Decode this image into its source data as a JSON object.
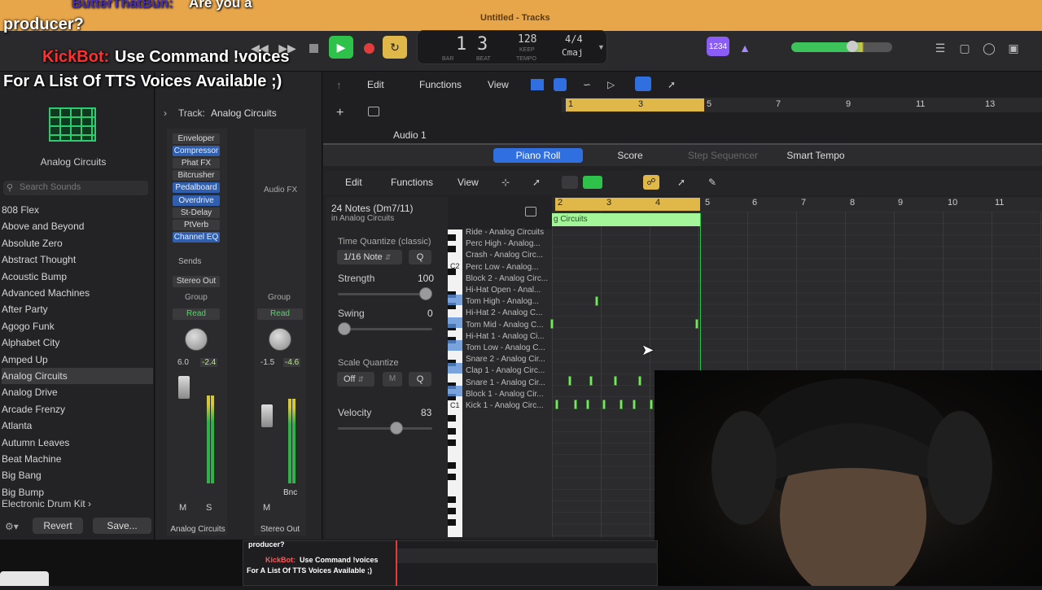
{
  "window": {
    "title": "Untitled - Tracks"
  },
  "chat": {
    "line1_user": "ButterThatBun:",
    "line1_msg": "Are you a",
    "line1b": "producer?",
    "line2_user": "KickBot:",
    "line2_msg": "Use Command !voices",
    "line3": "For A List Of TTS Voices Available ;)"
  },
  "lcd": {
    "bar": "1",
    "beat": "3",
    "bar_label": "BAR",
    "beat_label": "BEAT",
    "tempo": "128",
    "tempo_mode": "KEEP",
    "tempo_label": "TEMPO",
    "time_sig": "4/4",
    "key": "Cmaj",
    "count_in": "1234"
  },
  "library": {
    "patch_name": "Analog Circuits",
    "search_placeholder": "Search Sounds",
    "items": [
      "808 Flex",
      "Above and Beyond",
      "Absolute Zero",
      "Abstract Thought",
      "Acoustic Bump",
      "Advanced Machines",
      "After Party",
      "Agogo Funk",
      "Alphabet City",
      "Amped Up",
      "Analog Circuits",
      "Analog Drive",
      "Arcade Frenzy",
      "Atlanta",
      "Autumn Leaves",
      "Beat Machine",
      "Big Bang",
      "Big Bump"
    ],
    "selected": "Analog Circuits",
    "category": "Electronic Drum Kit",
    "revert": "Revert",
    "save": "Save..."
  },
  "inspector": {
    "track_label": "Track:",
    "track_name": "Analog Circuits",
    "plugins": [
      {
        "name": "Enveloper",
        "active": false
      },
      {
        "name": "Compressor",
        "active": true
      },
      {
        "name": "Phat FX",
        "active": false
      },
      {
        "name": "Bitcrusher",
        "active": false
      },
      {
        "name": "Pedalboard",
        "active": true
      },
      {
        "name": "Overdrive",
        "active": true
      },
      {
        "name": "St-Delay",
        "active": false
      },
      {
        "name": "PtVerb",
        "active": false
      },
      {
        "name": "Channel EQ",
        "active": true
      }
    ],
    "audio_fx": "Audio FX",
    "sends": "Sends",
    "output": "Stereo Out",
    "group": "Group",
    "read": "Read",
    "ch1_vol": "6.0",
    "ch1_peak": "-2.4",
    "ch2_vol": "-1.5",
    "ch2_peak": "-4.6",
    "bnc": "Bnc",
    "m": "M",
    "s": "S",
    "ch1_name": "Analog Circuits",
    "ch2_name": "Stereo Out"
  },
  "tracks": {
    "menus": [
      "Edit",
      "Functions",
      "View"
    ],
    "ruler": [
      "1",
      "3",
      "5",
      "7",
      "9",
      "11",
      "13"
    ],
    "audio_track": "Audio 1"
  },
  "piano_roll": {
    "tabs": [
      "Piano Roll",
      "Score",
      "Step Sequencer",
      "Smart Tempo"
    ],
    "menus": [
      "Edit",
      "Functions",
      "View"
    ],
    "region_info": "24 Notes (Dm7/11)",
    "region_track": "in Analog Circuits",
    "region_name": "g Circuits",
    "time_quantize_label": "Time Quantize (classic)",
    "time_quantize_value": "1/16 Note",
    "q": "Q",
    "strength_label": "Strength",
    "strength_value": "100",
    "swing_label": "Swing",
    "swing_value": "0",
    "scale_quantize_label": "Scale Quantize",
    "scale_off": "Off",
    "scale_key": "M",
    "velocity_label": "Velocity",
    "velocity_value": "83",
    "ruler": [
      "2",
      "3",
      "4",
      "5",
      "6",
      "7",
      "8",
      "9",
      "10",
      "11"
    ],
    "key_c2": "C2",
    "key_c1": "C1",
    "drums": [
      "Ride - Analog Circuits",
      "Perc High - Analog...",
      "Crash - Analog Circ...",
      "Perc Low - Analog...",
      "Block 2 - Analog Circ...",
      "Hi-Hat Open - Anal...",
      "Tom High - Analog...",
      "Hi-Hat 2 - Analog C...",
      "Tom Mid - Analog C...",
      "Hi-Hat 1 - Analog Ci...",
      "Tom Low - Analog C...",
      "Snare 2 - Analog Cir...",
      "Clap 1 - Analog Circ...",
      "Snare 1 - Analog Cir...",
      "Block 1 - Analog Cir...",
      "Kick 1 - Analog Circ..."
    ]
  },
  "pip_chat": {
    "l1": "producer?",
    "l2_user": "KickBot:",
    "l2_msg": "Use Command !voices",
    "l3": "For A List Of TTS Voices Available ;)"
  },
  "colors": {
    "accent_blue": "#2f6fe0",
    "note_green": "#7fe06a",
    "play_green": "#2fc24b",
    "record_red": "#e23c3c",
    "cycle_yellow": "#e0b84a",
    "title_orange": "#e8a64a"
  }
}
